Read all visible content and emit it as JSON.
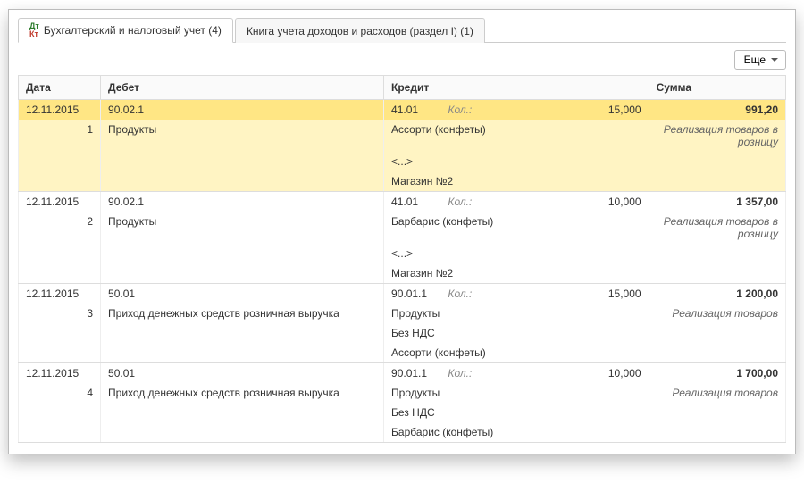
{
  "tabs": [
    {
      "label": "Бухгалтерский и налоговый учет (4)",
      "active": true
    },
    {
      "label": "Книга учета доходов и расходов (раздел I) (1)",
      "active": false
    }
  ],
  "toolbar": {
    "more": "Еще"
  },
  "header": {
    "date": "Дата",
    "debet": "Дебет",
    "credit": "Кредит",
    "sum": "Сумма"
  },
  "kolLabel": "Кол.:",
  "dots": "<...>",
  "rows": [
    {
      "sel": true,
      "date": "12.11.2015",
      "n": "1",
      "debAcc": "90.02.1",
      "debSub": "Продукты",
      "crAcc": "41.01",
      "crQty": "15,000",
      "crSub1": "Ассорти (конфеты)",
      "crSub3": "Магазин №2",
      "sum": "991,20",
      "note": "Реализация товаров в розницу"
    },
    {
      "date": "12.11.2015",
      "n": "2",
      "debAcc": "90.02.1",
      "debSub": "Продукты",
      "crAcc": "41.01",
      "crQty": "10,000",
      "crSub1": "Барбарис (конфеты)",
      "crSub3": "Магазин №2",
      "sum": "1 357,00",
      "note": "Реализация товаров в розницу"
    },
    {
      "date": "12.11.2015",
      "n": "3",
      "debAcc": "50.01",
      "debSub": "Приход денежных средств розничная выручка",
      "crAcc": "90.01.1",
      "crQty": "15,000",
      "crSub1": "Продукты",
      "crSub2": "Без НДС",
      "crSub3": "Ассорти (конфеты)",
      "sum": "1 200,00",
      "note": "Реализация товаров"
    },
    {
      "date": "12.11.2015",
      "n": "4",
      "debAcc": "50.01",
      "debSub": "Приход денежных средств розничная выручка",
      "crAcc": "90.01.1",
      "crQty": "10,000",
      "crSub1": "Продукты",
      "crSub2": "Без НДС",
      "crSub3": "Барбарис (конфеты)",
      "sum": "1 700,00",
      "note": "Реализация товаров"
    }
  ]
}
